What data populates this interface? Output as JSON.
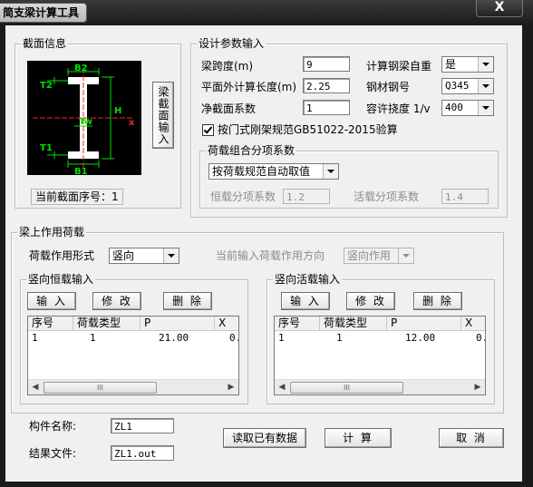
{
  "window": {
    "title": "简支梁计算工具",
    "close_symbol": "X"
  },
  "section_info": {
    "group_title": "截面信息",
    "figure_labels": {
      "B2": "B2",
      "T2": "T2",
      "Tw": "Tw",
      "H": "H",
      "T1": "T1",
      "B1": "B1",
      "x": "x"
    },
    "input_button": "梁截面输入",
    "current_index_label": "当前截面序号：1"
  },
  "design_params": {
    "group_title": "设计参数输入",
    "span_label": "梁跨度(m)",
    "span_value": "9",
    "out_of_plane_label": "平面外计算长度(m)",
    "out_of_plane_value": "2.25",
    "net_section_label": "净截面系数",
    "net_section_value": "1",
    "self_weight_label": "计算钢梁自重",
    "self_weight_value": "是",
    "steel_label": "钢材钢号",
    "steel_value": "Q345",
    "deflection_label": "容许挠度 1/v",
    "deflection_value": "400",
    "checkbox_label": "按门式刚架规范GB51022-2015验算",
    "factors": {
      "group_title": "荷载组合分项系数",
      "mode_value": "按荷载规范自动取值",
      "dead_label": "恒载分项系数",
      "dead_value": "1.2",
      "live_label": "活载分项系数",
      "live_value": "1.4"
    }
  },
  "loads": {
    "group_title": "梁上作用荷载",
    "form_label": "荷载作用形式",
    "form_value": "竖向",
    "direction_label": "当前输入荷载作用方向",
    "direction_value": "竖向作用",
    "dead": {
      "group_title": "竖向恒载输入",
      "buttons": {
        "input": "输 入",
        "edit": "修 改",
        "delete": "删 除"
      },
      "columns": [
        "序号",
        "荷载类型",
        "P",
        "X"
      ],
      "rows": [
        {
          "index": "1",
          "type": "1",
          "p": "21.00",
          "x": "0."
        }
      ]
    },
    "live": {
      "group_title": "竖向活载输入",
      "buttons": {
        "input": "输 入",
        "edit": "修 改",
        "delete": "删 除"
      },
      "columns": [
        "序号",
        "荷载类型",
        "P",
        "X"
      ],
      "rows": [
        {
          "index": "1",
          "type": "1",
          "p": "12.00",
          "x": "0."
        }
      ]
    },
    "scroll_thumb": "III"
  },
  "footer": {
    "member_label": "构件名称:",
    "member_value": "ZL1",
    "result_label": "结果文件:",
    "result_value": "ZL1.out",
    "read_button": "读取已有数据",
    "calc_button": "计 算",
    "cancel_button": "取 消"
  }
}
